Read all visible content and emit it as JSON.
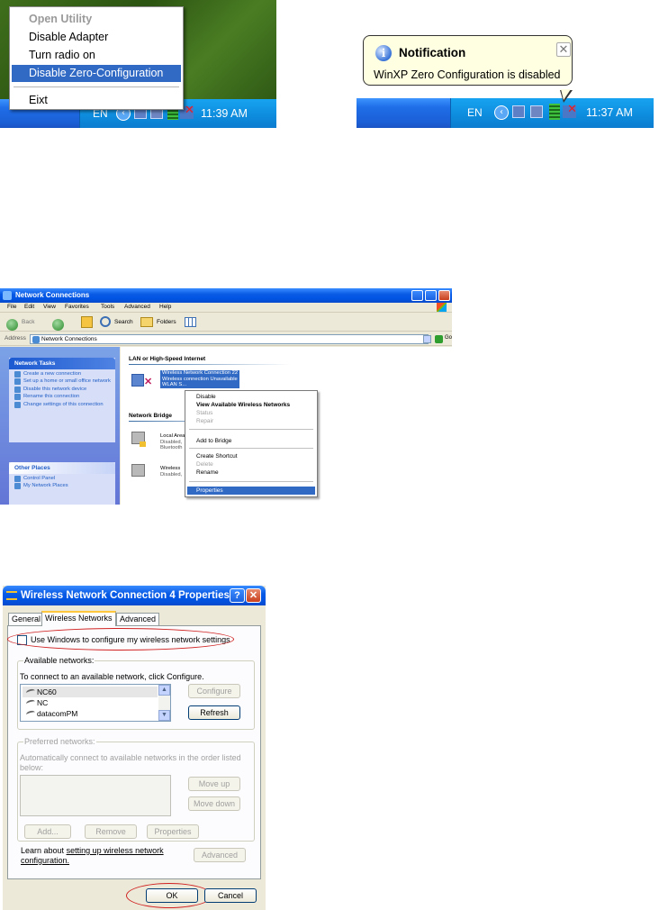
{
  "tray_menu": {
    "items": [
      "Open Utility",
      "Disable Adapter",
      "Turn radio on",
      "Disable Zero-Configuration",
      "Eixt"
    ],
    "lang": "EN",
    "time": "11:39 AM"
  },
  "notification": {
    "title": "Notification",
    "message": "WinXP Zero Configuration is disabled",
    "lang": "EN",
    "time": "11:37 AM"
  },
  "net_window": {
    "title": "Network Connections",
    "menu": [
      "File",
      "Edit",
      "View",
      "Favorites",
      "Tools",
      "Advanced",
      "Help"
    ],
    "toolbar": {
      "back": "Back",
      "search": "Search",
      "folders": "Folders"
    },
    "address_label": "Address",
    "address_value": "Network Connections",
    "go": "Go",
    "network_tasks": {
      "header": "Network Tasks",
      "items": [
        "Create a new connection",
        "Set up a home or small office network",
        "Disable this network device",
        "Rename this connection",
        "Change settings of this connection"
      ]
    },
    "other_places": {
      "header": "Other Places",
      "items": [
        "Control Panel",
        "My Network Places"
      ]
    },
    "groups": {
      "lan": "LAN or High-Speed Internet",
      "bridge": "Network Bridge"
    },
    "selected_conn": [
      "Wireless Network Connection 22",
      "Wireless connection Unavailable",
      "WLAN S..."
    ],
    "local_conn": [
      "Local Area",
      "Disabled,",
      "Bluetooth"
    ],
    "wireless_conn": [
      "Wireless",
      "Disabled,"
    ],
    "context_menu": [
      "Disable",
      "View Available Wireless Networks",
      "Status",
      "Repair",
      "Add to Bridge",
      "Create Shortcut",
      "Delete",
      "Rename",
      "Properties"
    ]
  },
  "props_dialog": {
    "title": "Wireless Network Connection 4 Properties",
    "tabs": [
      "General",
      "Wireless Networks",
      "Advanced"
    ],
    "use_windows_checkbox": "Use Windows to configure my wireless network settings",
    "available_legend": "Available networks:",
    "available_hint": "To connect to an available network, click Configure.",
    "networks": [
      "NC60",
      "NC",
      "datacomPM"
    ],
    "configure": "Configure",
    "refresh": "Refresh",
    "preferred_legend": "Preferred networks:",
    "preferred_hint_1": "Automatically connect to available networks in the order listed",
    "preferred_hint_2": "below:",
    "move_up": "Move up",
    "move_down": "Move down",
    "add": "Add...",
    "remove": "Remove",
    "properties": "Properties",
    "learn_prefix": "Learn about",
    "learn_link": "setting up wireless network",
    "learn_link2": "configuration.",
    "advanced_btn": "Advanced",
    "ok": "OK",
    "cancel": "Cancel"
  }
}
